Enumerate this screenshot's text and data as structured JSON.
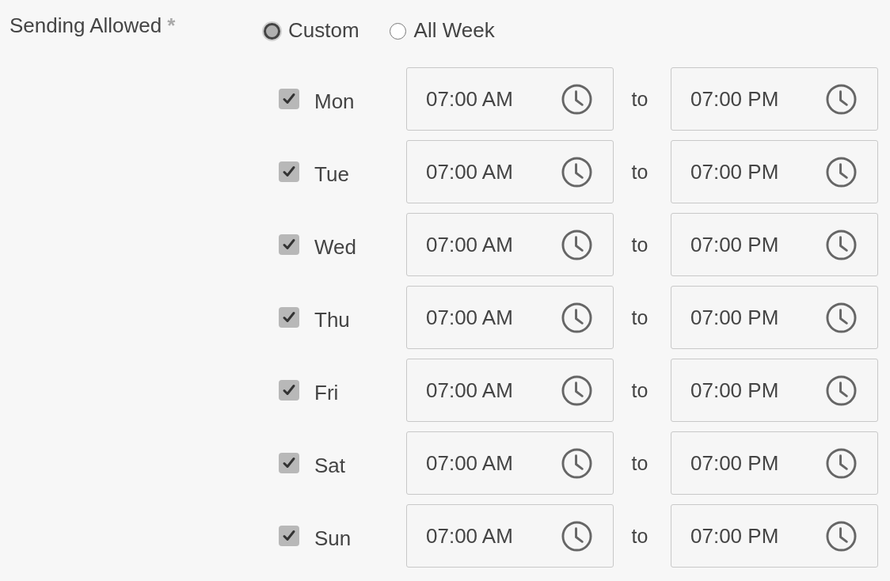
{
  "field": {
    "label": "Sending Allowed",
    "required_mark": "*"
  },
  "mode_options": [
    {
      "label": "Custom",
      "selected": true
    },
    {
      "label": "All Week",
      "selected": false
    }
  ],
  "days": [
    {
      "label": "Mon",
      "checked": true,
      "start": "07:00 AM",
      "separator": "to",
      "end": "07:00 PM"
    },
    {
      "label": "Tue",
      "checked": true,
      "start": "07:00 AM",
      "separator": "to",
      "end": "07:00 PM"
    },
    {
      "label": "Wed",
      "checked": true,
      "start": "07:00 AM",
      "separator": "to",
      "end": "07:00 PM"
    },
    {
      "label": "Thu",
      "checked": true,
      "start": "07:00 AM",
      "separator": "to",
      "end": "07:00 PM"
    },
    {
      "label": "Fri",
      "checked": true,
      "start": "07:00 AM",
      "separator": "to",
      "end": "07:00 PM"
    },
    {
      "label": "Sat",
      "checked": true,
      "start": "07:00 AM",
      "separator": "to",
      "end": "07:00 PM"
    },
    {
      "label": "Sun",
      "checked": true,
      "start": "07:00 AM",
      "separator": "to",
      "end": "07:00 PM"
    }
  ]
}
